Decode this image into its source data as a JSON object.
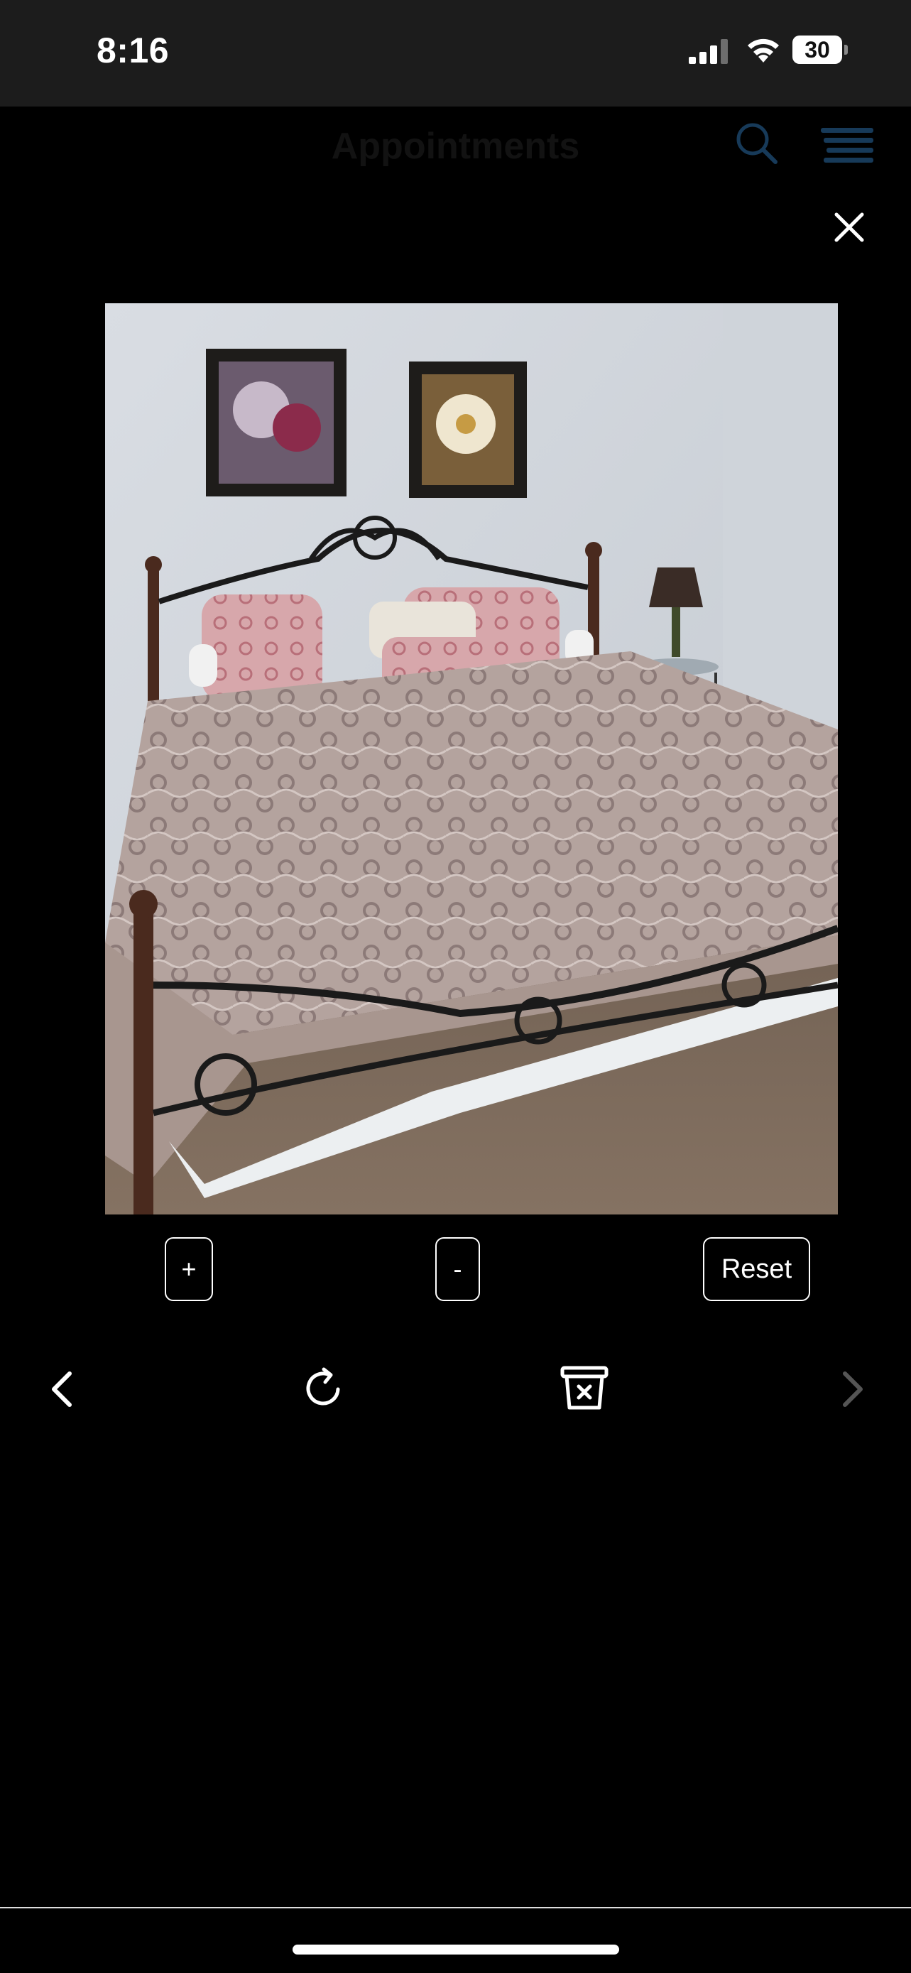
{
  "status_bar": {
    "time": "8:16",
    "battery_level": "30"
  },
  "app_header": {
    "title": "Appointments",
    "search_icon": "search-icon",
    "menu_icon": "hamburger-menu-icon"
  },
  "viewer": {
    "close_icon": "close-icon",
    "zoom_in_label": "+",
    "zoom_out_label": "-",
    "reset_label": "Reset",
    "prev_icon": "chevron-left-icon",
    "rotate_icon": "rotate-icon",
    "delete_icon": "trash-icon",
    "next_icon": "chevron-right-icon"
  },
  "colors": {
    "status_bar_bg": "#1c1c1c",
    "sheet_bg": "#000000",
    "control_border": "#ffffff",
    "next_disabled": "#555555"
  }
}
